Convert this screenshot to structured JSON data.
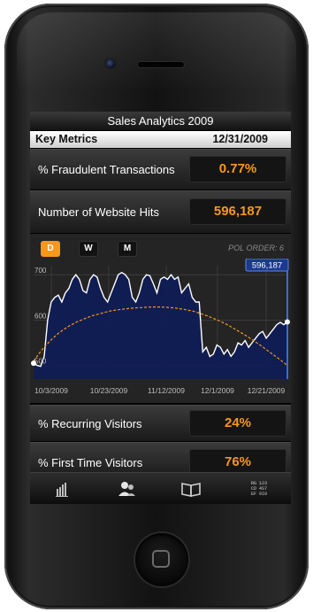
{
  "app": {
    "title": "Sales Analytics 2009",
    "header_label": "Key Metrics",
    "header_date": "12/31/2009"
  },
  "metrics": [
    {
      "label": "% Fraudulent Transactions",
      "value": "0.77%"
    },
    {
      "label": "Number of Website Hits",
      "value": "596,187"
    },
    {
      "label": "% Recurring Visitors",
      "value": "24%"
    },
    {
      "label": "% First Time Visitors",
      "value": "76%"
    }
  ],
  "chart_controls": {
    "range_buttons": [
      "D",
      "W",
      "M"
    ],
    "selected": "D",
    "poly_order_label": "POL ORDER: 6"
  },
  "chart_data": {
    "type": "area",
    "yticks": [
      "700",
      "600",
      "500"
    ],
    "ylim": [
      470,
      720
    ],
    "xticks": [
      "10/3/2009",
      "10/23/2009",
      "11/12/2009",
      "12/1/2009",
      "12/21/2009"
    ],
    "tooltip_value": "596,187",
    "series": [
      {
        "values": [
          505,
          500,
          498,
          520,
          600,
          640,
          650,
          655,
          640,
          660,
          670,
          690,
          700,
          690,
          665,
          660,
          690,
          700,
          695,
          670,
          650,
          640,
          660,
          680,
          700,
          705,
          700,
          690,
          650,
          640,
          660,
          690,
          700,
          698,
          680,
          660,
          690,
          695,
          690,
          700,
          690,
          695,
          660,
          670,
          680,
          650,
          640,
          640,
          530,
          540,
          520,
          525,
          545,
          540,
          525,
          535,
          520,
          530,
          550,
          545,
          555,
          540,
          550,
          560,
          570,
          575,
          560,
          570,
          580,
          590,
          595,
          590,
          596
        ],
        "color": "#2a4aa8",
        "fill": "#101e55"
      },
      {
        "values": [
          510,
          535,
          555,
          572,
          585,
          595,
          603,
          610,
          615,
          620,
          623,
          625,
          627,
          628,
          629,
          629,
          628,
          626,
          623,
          619,
          613,
          606,
          598,
          589,
          578,
          567,
          555,
          542,
          528,
          515,
          500
        ],
        "color": "#f7981d",
        "style": "dashed"
      }
    ],
    "colors": {
      "accent": "#f7981d",
      "marker_line": "#2f6fe0"
    }
  },
  "tab_bar": {
    "items": [
      "bar-chart-icon",
      "users-icon",
      "book-icon",
      "data-grid-icon"
    ],
    "data_grid_glyph": "RG 123\nCD 4S7\nEF 9I0"
  }
}
